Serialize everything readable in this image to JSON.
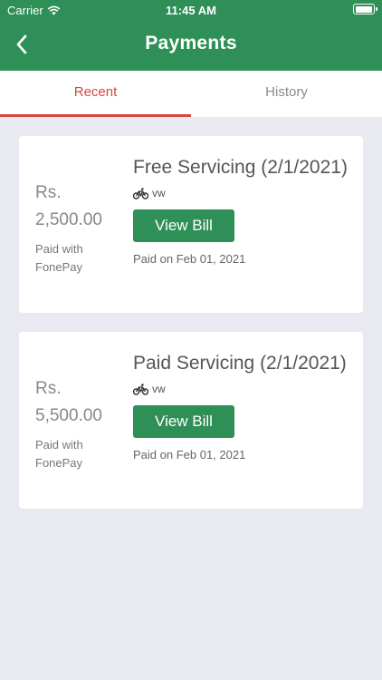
{
  "status_bar": {
    "carrier": "Carrier",
    "time": "11:45 AM",
    "battery_level": 1.0
  },
  "header": {
    "title": "Payments",
    "back_icon": "chevron-left-icon"
  },
  "tabs": [
    {
      "label": "Recent",
      "active": true
    },
    {
      "label": "History",
      "active": false
    }
  ],
  "payments": [
    {
      "currency": "Rs.",
      "amount": "2,500.00",
      "paid_with": "Paid with FonePay",
      "title": "Free Servicing (2/1/2021)",
      "vehicle": "vw",
      "vehicle_icon": "bicycle-icon",
      "button": "View Bill",
      "paid_on": "Paid on Feb 01, 2021"
    },
    {
      "currency": "Rs.",
      "amount": "5,500.00",
      "paid_with": "Paid with FonePay",
      "title": "Paid Servicing (2/1/2021)",
      "vehicle": "vw",
      "vehicle_icon": "bicycle-icon",
      "button": "View Bill",
      "paid_on": "Paid on Feb 01, 2021"
    }
  ],
  "colors": {
    "header": "#2e8f57",
    "accent": "#d44a3c",
    "background": "#e9e9f1"
  }
}
